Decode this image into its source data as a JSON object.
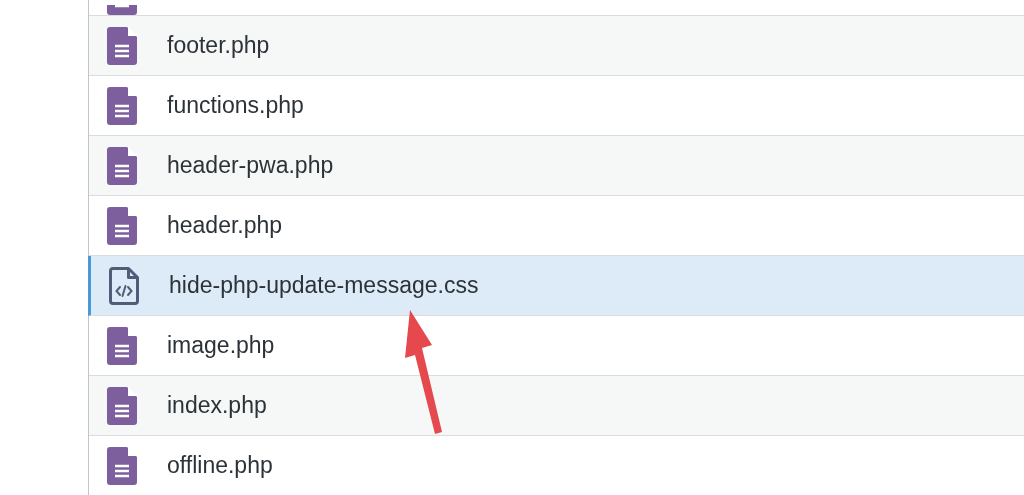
{
  "files": [
    {
      "kind": "document",
      "selected": false
    },
    {
      "kind": "document",
      "name": "footer.php",
      "selected": false
    },
    {
      "kind": "document",
      "name": "functions.php",
      "selected": false
    },
    {
      "kind": "document",
      "name": "header-pwa.php",
      "selected": false
    },
    {
      "kind": "document",
      "name": "header.php",
      "selected": false
    },
    {
      "kind": "code",
      "name": "hide-php-update-message.css",
      "selected": true
    },
    {
      "kind": "document",
      "name": "image.php",
      "selected": false
    },
    {
      "kind": "document",
      "name": "index.php",
      "selected": false
    },
    {
      "kind": "document",
      "name": "offline.php",
      "selected": false
    }
  ]
}
